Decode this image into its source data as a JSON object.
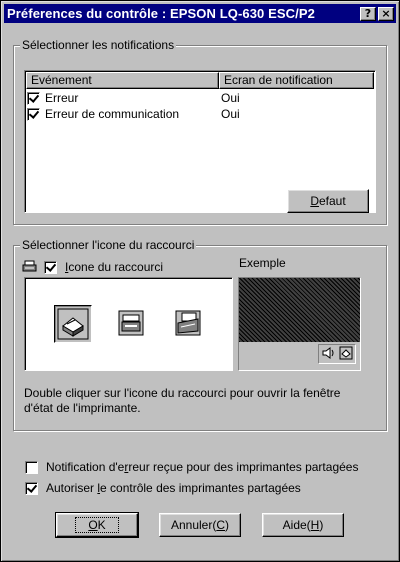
{
  "window": {
    "title": "Préferences du contrôle : EPSON LQ-630 ESC/P2",
    "help_button": "?",
    "close_button": "×"
  },
  "notifications": {
    "group_label": "Sélectionner les notifications",
    "columns": [
      "Evénement",
      "Ecran de notification"
    ],
    "rows": [
      {
        "event": "Erreur",
        "display": "Oui",
        "checked": true
      },
      {
        "event": "Erreur de communication",
        "display": "Oui",
        "checked": true
      }
    ],
    "default_button": "Defaut",
    "default_button_mnemonic": "D"
  },
  "shortcut": {
    "group_label": "Sélectionner l'icone du raccourci",
    "checkbox_label": "Icone du raccourci",
    "checkbox_mnemonic": "I",
    "checked": true,
    "example_label": "Exemple",
    "description": "Double cliquer sur l'icone du raccourci pour ouvrir la fenêtre d'état de l'imprimante."
  },
  "options": [
    {
      "label_before": "Notification d'e",
      "mnemonic": "r",
      "label_after": "reur reçue pour des imprimantes partagées",
      "checked": false
    },
    {
      "label_before": "Autoriser ",
      "mnemonic": "l",
      "label_after": "e contrôle des imprimantes partagées",
      "checked": true
    }
  ],
  "buttons": {
    "ok": {
      "mnemonic": "O",
      "rest": "K"
    },
    "cancel": {
      "text": "Annuler(",
      "mnemonic": "C",
      "rest": ")"
    },
    "help": {
      "text": "Aide(",
      "mnemonic": "H",
      "rest": ")"
    }
  },
  "colors": {
    "title_bar": "#000080",
    "face": "#c0c0c0"
  }
}
